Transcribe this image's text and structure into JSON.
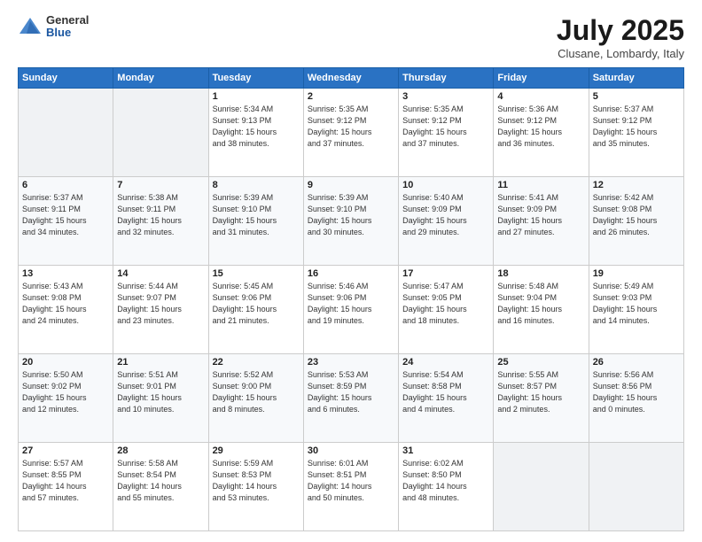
{
  "logo": {
    "general": "General",
    "blue": "Blue"
  },
  "header": {
    "title": "July 2025",
    "location": "Clusane, Lombardy, Italy"
  },
  "weekdays": [
    "Sunday",
    "Monday",
    "Tuesday",
    "Wednesday",
    "Thursday",
    "Friday",
    "Saturday"
  ],
  "weeks": [
    [
      {
        "day": "",
        "detail": ""
      },
      {
        "day": "",
        "detail": ""
      },
      {
        "day": "1",
        "detail": "Sunrise: 5:34 AM\nSunset: 9:13 PM\nDaylight: 15 hours\nand 38 minutes."
      },
      {
        "day": "2",
        "detail": "Sunrise: 5:35 AM\nSunset: 9:12 PM\nDaylight: 15 hours\nand 37 minutes."
      },
      {
        "day": "3",
        "detail": "Sunrise: 5:35 AM\nSunset: 9:12 PM\nDaylight: 15 hours\nand 37 minutes."
      },
      {
        "day": "4",
        "detail": "Sunrise: 5:36 AM\nSunset: 9:12 PM\nDaylight: 15 hours\nand 36 minutes."
      },
      {
        "day": "5",
        "detail": "Sunrise: 5:37 AM\nSunset: 9:12 PM\nDaylight: 15 hours\nand 35 minutes."
      }
    ],
    [
      {
        "day": "6",
        "detail": "Sunrise: 5:37 AM\nSunset: 9:11 PM\nDaylight: 15 hours\nand 34 minutes."
      },
      {
        "day": "7",
        "detail": "Sunrise: 5:38 AM\nSunset: 9:11 PM\nDaylight: 15 hours\nand 32 minutes."
      },
      {
        "day": "8",
        "detail": "Sunrise: 5:39 AM\nSunset: 9:10 PM\nDaylight: 15 hours\nand 31 minutes."
      },
      {
        "day": "9",
        "detail": "Sunrise: 5:39 AM\nSunset: 9:10 PM\nDaylight: 15 hours\nand 30 minutes."
      },
      {
        "day": "10",
        "detail": "Sunrise: 5:40 AM\nSunset: 9:09 PM\nDaylight: 15 hours\nand 29 minutes."
      },
      {
        "day": "11",
        "detail": "Sunrise: 5:41 AM\nSunset: 9:09 PM\nDaylight: 15 hours\nand 27 minutes."
      },
      {
        "day": "12",
        "detail": "Sunrise: 5:42 AM\nSunset: 9:08 PM\nDaylight: 15 hours\nand 26 minutes."
      }
    ],
    [
      {
        "day": "13",
        "detail": "Sunrise: 5:43 AM\nSunset: 9:08 PM\nDaylight: 15 hours\nand 24 minutes."
      },
      {
        "day": "14",
        "detail": "Sunrise: 5:44 AM\nSunset: 9:07 PM\nDaylight: 15 hours\nand 23 minutes."
      },
      {
        "day": "15",
        "detail": "Sunrise: 5:45 AM\nSunset: 9:06 PM\nDaylight: 15 hours\nand 21 minutes."
      },
      {
        "day": "16",
        "detail": "Sunrise: 5:46 AM\nSunset: 9:06 PM\nDaylight: 15 hours\nand 19 minutes."
      },
      {
        "day": "17",
        "detail": "Sunrise: 5:47 AM\nSunset: 9:05 PM\nDaylight: 15 hours\nand 18 minutes."
      },
      {
        "day": "18",
        "detail": "Sunrise: 5:48 AM\nSunset: 9:04 PM\nDaylight: 15 hours\nand 16 minutes."
      },
      {
        "day": "19",
        "detail": "Sunrise: 5:49 AM\nSunset: 9:03 PM\nDaylight: 15 hours\nand 14 minutes."
      }
    ],
    [
      {
        "day": "20",
        "detail": "Sunrise: 5:50 AM\nSunset: 9:02 PM\nDaylight: 15 hours\nand 12 minutes."
      },
      {
        "day": "21",
        "detail": "Sunrise: 5:51 AM\nSunset: 9:01 PM\nDaylight: 15 hours\nand 10 minutes."
      },
      {
        "day": "22",
        "detail": "Sunrise: 5:52 AM\nSunset: 9:00 PM\nDaylight: 15 hours\nand 8 minutes."
      },
      {
        "day": "23",
        "detail": "Sunrise: 5:53 AM\nSunset: 8:59 PM\nDaylight: 15 hours\nand 6 minutes."
      },
      {
        "day": "24",
        "detail": "Sunrise: 5:54 AM\nSunset: 8:58 PM\nDaylight: 15 hours\nand 4 minutes."
      },
      {
        "day": "25",
        "detail": "Sunrise: 5:55 AM\nSunset: 8:57 PM\nDaylight: 15 hours\nand 2 minutes."
      },
      {
        "day": "26",
        "detail": "Sunrise: 5:56 AM\nSunset: 8:56 PM\nDaylight: 15 hours\nand 0 minutes."
      }
    ],
    [
      {
        "day": "27",
        "detail": "Sunrise: 5:57 AM\nSunset: 8:55 PM\nDaylight: 14 hours\nand 57 minutes."
      },
      {
        "day": "28",
        "detail": "Sunrise: 5:58 AM\nSunset: 8:54 PM\nDaylight: 14 hours\nand 55 minutes."
      },
      {
        "day": "29",
        "detail": "Sunrise: 5:59 AM\nSunset: 8:53 PM\nDaylight: 14 hours\nand 53 minutes."
      },
      {
        "day": "30",
        "detail": "Sunrise: 6:01 AM\nSunset: 8:51 PM\nDaylight: 14 hours\nand 50 minutes."
      },
      {
        "day": "31",
        "detail": "Sunrise: 6:02 AM\nSunset: 8:50 PM\nDaylight: 14 hours\nand 48 minutes."
      },
      {
        "day": "",
        "detail": ""
      },
      {
        "day": "",
        "detail": ""
      }
    ]
  ]
}
